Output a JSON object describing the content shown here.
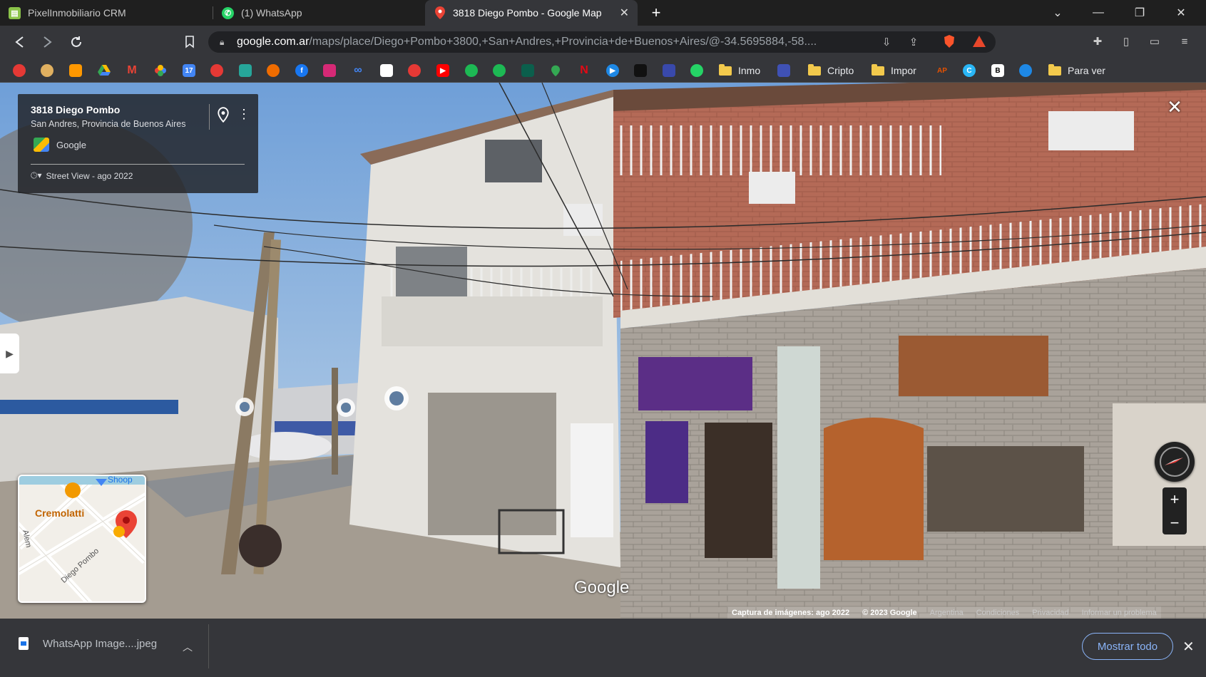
{
  "tabs": [
    {
      "title": "PixelInmobiliario CRM",
      "icon": "crm-favicon",
      "color": "#8bc34a"
    },
    {
      "title": "(1) WhatsApp",
      "icon": "whatsapp-favicon",
      "color": "#25d366"
    },
    {
      "title": "3818 Diego Pombo - Google Map",
      "icon": "google-maps-favicon",
      "color": "#ea4335",
      "active": true
    }
  ],
  "new_tab": "+",
  "window_controls": {
    "tab_search": "⌄",
    "minimize": "—",
    "restore": "❐",
    "close": "✕"
  },
  "address": {
    "host": "google.com.ar",
    "path": "/maps/place/Diego+Pombo+3800,+San+Andres,+Provincia+de+Buenos+Aires/@-34.5695884,-58...."
  },
  "bookmarks": {
    "icons": [
      "red-app",
      "bowl",
      "orange-bars",
      "google-drive",
      "gmail",
      "google-photos",
      "calendar",
      "circle-app",
      "building-app",
      "orange-circle",
      "facebook",
      "instagram",
      "meta",
      "google-ads",
      "red-target",
      "youtube",
      "green-circle",
      "spotify",
      "dark-green-app",
      "google-maps",
      "netflix",
      "blue-play",
      "dark-app",
      "red-blue-flag",
      "whatsapp"
    ],
    "folders": [
      {
        "label": "Inmo"
      },
      {
        "label": "Cripto"
      },
      {
        "label": "Impor"
      },
      {
        "label": "Para ver"
      }
    ],
    "extra_icons": [
      "ap-logo",
      "c-logo",
      "b-logo",
      "blue-dot"
    ]
  },
  "info_card": {
    "title": "3818 Diego Pombo",
    "subtitle": "San Andres, Provincia de Buenos Aires",
    "provider": "Google",
    "history": "Street View - ago 2022"
  },
  "minimap": {
    "place_label": "Cremolatti",
    "street_label_1": "Diego Pombo",
    "street_label_2": "Alem",
    "corner_label": "Shoop"
  },
  "watermark": "Google",
  "footer": {
    "capture": "Captura de imágenes: ago 2022",
    "copyright": "© 2023 Google",
    "country": "Argentina",
    "terms": "Condiciones",
    "privacy": "Privacidad",
    "report": "Informar un problema"
  },
  "zoom": {
    "plus": "+",
    "minus": "−"
  },
  "downloads": {
    "file_name": "WhatsApp Image....jpeg",
    "show_all": "Mostrar todo"
  },
  "colors": {
    "accent": "#8ab4f8",
    "toolbar": "#35363a",
    "tabbar": "#1f1f1f"
  }
}
